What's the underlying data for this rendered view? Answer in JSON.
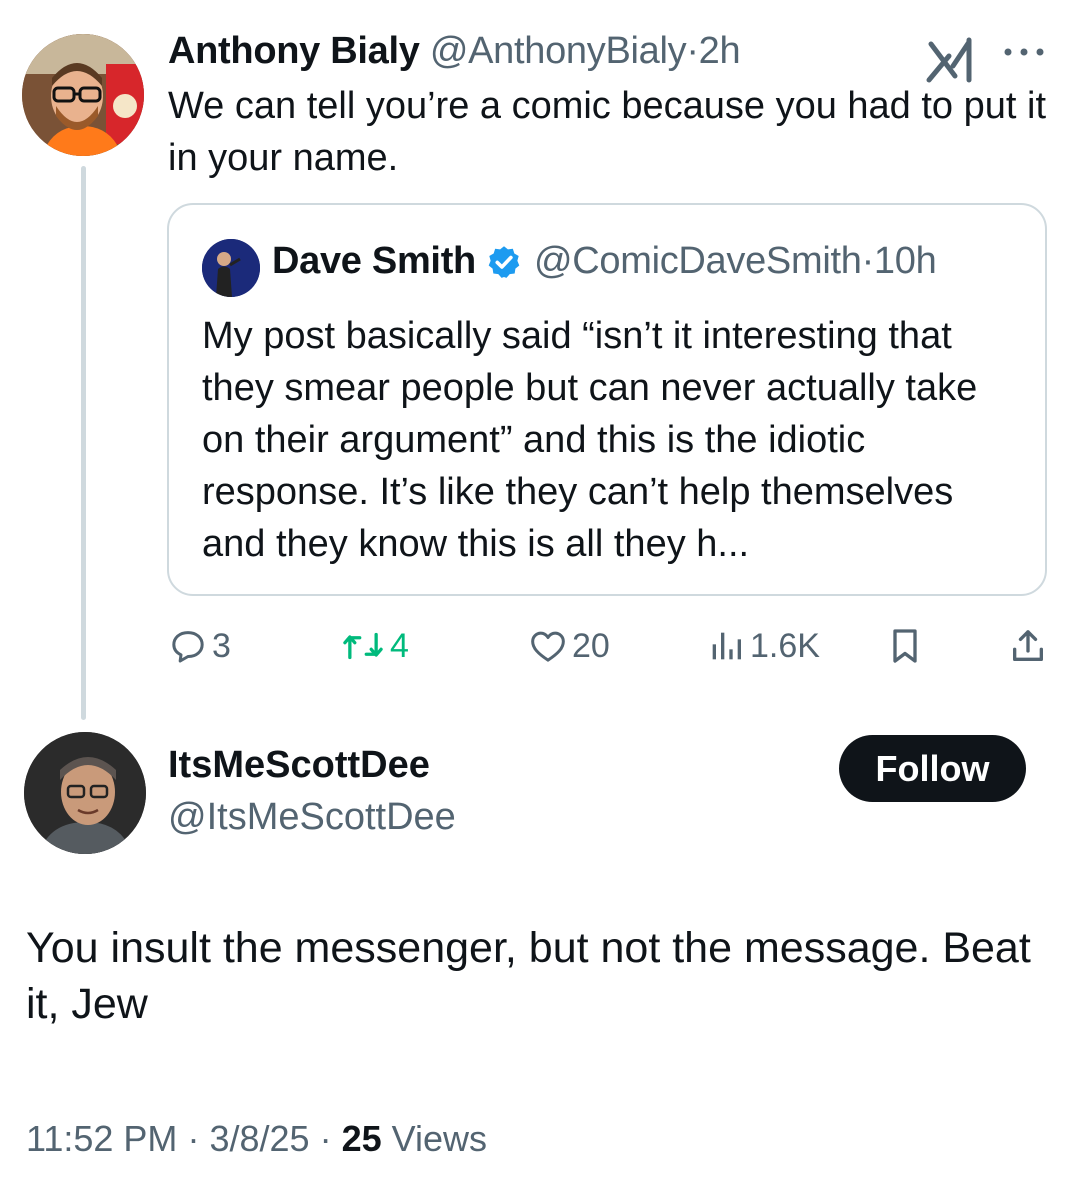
{
  "parent_tweet": {
    "author_name": "Anthony Bialy",
    "handle": "@AnthonyBialy",
    "separator": "·",
    "time": "2h",
    "text": "We can tell you’re a comic because you had to put it in your name.",
    "avatar_icon": "user-avatar-photo",
    "quote": {
      "author_name": "Dave Smith",
      "verified_icon": "verified-badge-icon",
      "verified_color": "#1d9bf0",
      "handle": "@ComicDaveSmith",
      "separator": "·",
      "time": "10h",
      "text": "My post basically said “isn’t it interesting that they smear people but can never actually take on their argument” and this is the idiotic response. It’s like they can’t help themselves and they know this is all they h..."
    },
    "actions": {
      "replies": "3",
      "reposts": "4",
      "likes": "20",
      "views": "1.6K"
    }
  },
  "reply_tweet": {
    "author_name": "ItsMeScottDee",
    "handle": "@ItsMeScottDee",
    "follow_label": "Follow",
    "text": "You insult the messenger, but not the message. Beat it, Jew",
    "time": "11:52 PM",
    "sep1": "·",
    "date": "3/8/25",
    "sep2": "·",
    "views_count": "25",
    "views_label": "Views"
  },
  "colors": {
    "text": "#0f1419",
    "muted": "#536471",
    "repost_green": "#00ba7c",
    "border": "#cfd9de"
  }
}
